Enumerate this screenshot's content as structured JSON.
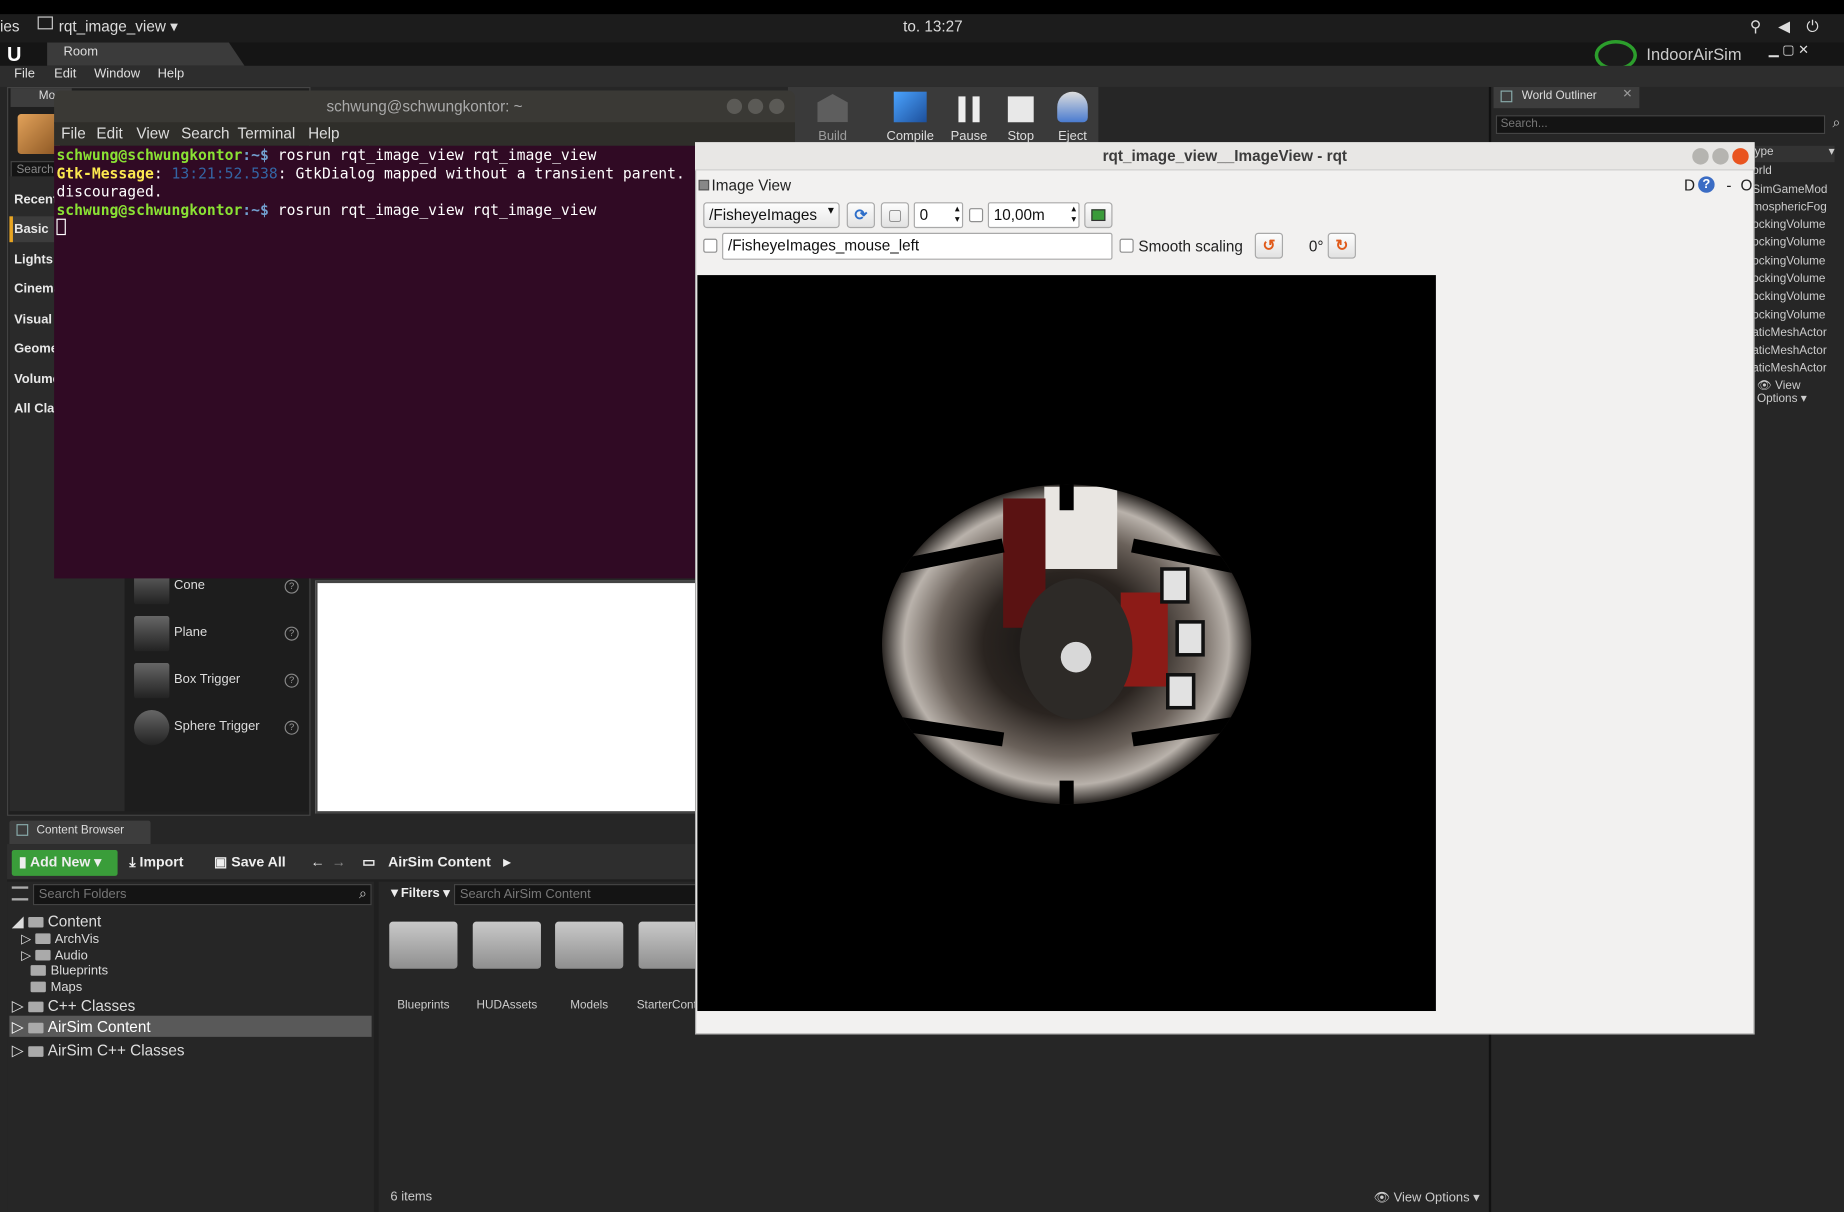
{
  "topbar": {
    "app_fragment": "ies",
    "window_menu": "rqt_image_view",
    "clock": "to. 13:27"
  },
  "unreal": {
    "tab": "Room",
    "project": "IndoorAirSim",
    "menu": [
      "File",
      "Edit",
      "Window",
      "Help"
    ],
    "toolbar": {
      "build": "Build",
      "compile": "Compile",
      "pause": "Pause",
      "stop": "Stop",
      "eject": "Eject"
    },
    "modes": {
      "tab_fragment": "Mo",
      "search_fragment": "Search",
      "categories": [
        "Recent",
        "Basic",
        "Lights",
        "Cinema",
        "Visual I",
        "Geome",
        "Volume",
        "All Clas"
      ],
      "placeables": [
        "Cone",
        "Plane",
        "Box Trigger",
        "Sphere Trigger"
      ],
      "help_glyph": "?"
    },
    "content_browser": {
      "tab": "Content Browser",
      "add_new": "Add New",
      "import": "Import",
      "save_all": "Save All",
      "path": "AirSim Content",
      "search_folders": "Search Folders",
      "filters": "Filters",
      "search_content": "Search AirSim Content",
      "tree": {
        "content": "Content",
        "children": [
          "ArchVis",
          "Audio",
          "Blueprints",
          "Maps"
        ],
        "cpp_classes": "C++ Classes",
        "airsim_content": "AirSim Content",
        "airsim_cpp": "AirSim C++ Classes"
      },
      "folders": [
        "Blueprints",
        "HUDAssets",
        "Models",
        "StarterCont"
      ],
      "items_count": "6 items",
      "view_options": "View Options"
    },
    "world_outliner": {
      "tab": "World Outliner",
      "search": "Search...",
      "type_header": "ype",
      "items": [
        "orld",
        "SimGameMod",
        "mosphericFog",
        "ockingVolume",
        "ockingVolume",
        "ockingVolume",
        "ockingVolume",
        "ockingVolume",
        "ockingVolume",
        "aticMeshActor",
        "aticMeshActor",
        "aticMeshActor"
      ],
      "view_options": "View Options"
    }
  },
  "terminal": {
    "title": "schwung@schwungkontor: ~",
    "menu": [
      "File",
      "Edit",
      "View",
      "Search",
      "Terminal",
      "Help"
    ],
    "user_host": "schwung@schwungkontor",
    "path_prompt": ":~$",
    "cmd": " rosrun rqt_image_view rqt_image_view",
    "gtk_label": "Gtk-Message",
    "colon1": ": ",
    "timestamp": "13:21:52.538",
    "gtk_msg": ": GtkDialog mapped without a transient parent.",
    "gtk_msg2": "discouraged."
  },
  "rqt": {
    "title": "rqt_image_view__ImageView - rqt",
    "panel_title": "Image View",
    "panel_d": "D",
    "panel_help": "?",
    "panel_dash": "-",
    "panel_o": "O",
    "topic": "/FisheyeImages",
    "spin_value": "0",
    "distance": "10,00m",
    "mouse_topic": "/FisheyeImages_mouse_left",
    "smooth_scaling": "Smooth scaling",
    "rotation": "0°"
  }
}
